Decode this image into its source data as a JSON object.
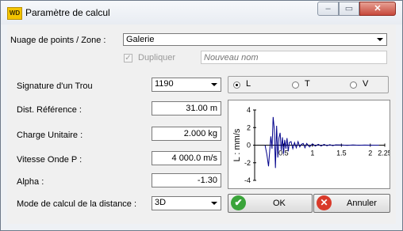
{
  "window": {
    "title": "Paramètre de calcul",
    "app_icon": "WD"
  },
  "titlebar_buttons": {
    "minimize": "–",
    "maximize": "▭",
    "close": "✕"
  },
  "zone": {
    "label": "Nuage de points / Zone :",
    "value": "Galerie"
  },
  "duplicate": {
    "label": "Dupliquer",
    "checked": true,
    "placeholder": "Nouveau nom"
  },
  "signature": {
    "label": "Signature d'un Trou",
    "value": "1190"
  },
  "reference": {
    "label": "Dist. Référence :",
    "value": "31.00 m"
  },
  "charge": {
    "label": "Charge Unitaire :",
    "value": "2.000 kg"
  },
  "vitesse": {
    "label": "Vitesse Onde P :",
    "value": "4 000.0 m/s"
  },
  "alpha": {
    "label": "Alpha :",
    "value": "-1.30"
  },
  "mode": {
    "label": "Mode de calcul de la distance :",
    "value": "3D"
  },
  "axis_radio": {
    "selected": "L",
    "options": [
      "L",
      "T",
      "V"
    ]
  },
  "buttons": {
    "ok": "OK",
    "cancel": "Annuler",
    "ok_icon": "✔",
    "cancel_icon": "✕"
  },
  "colors": {
    "series": "#00008b",
    "ok_green": "#3aa43a",
    "cancel_red": "#d93a2a"
  },
  "chart_data": {
    "type": "line",
    "ylabel": "L : mm/s",
    "xlabel": "",
    "xlim": [
      0,
      2.25
    ],
    "ylim": [
      -4,
      4
    ],
    "x_ticks": [
      "0.5",
      "1",
      "1.5",
      "2",
      "2.25"
    ],
    "y_ticks": [
      "4",
      "2",
      "0",
      "-2",
      "-4"
    ],
    "grid": false,
    "series": [
      {
        "name": "",
        "x": [
          0.18,
          0.21,
          0.24,
          0.26,
          0.28,
          0.3,
          0.32,
          0.34,
          0.36,
          0.38,
          0.4,
          0.42,
          0.44,
          0.46,
          0.48,
          0.5,
          0.52,
          0.54,
          0.56,
          0.58,
          0.6,
          0.63,
          0.66,
          0.69,
          0.72,
          0.75,
          0.78,
          0.81,
          0.84,
          0.87,
          0.9,
          0.95,
          1.0,
          1.05,
          1.1,
          1.15,
          1.2,
          1.25,
          1.3,
          1.35,
          1.4,
          1.5,
          1.6,
          1.7,
          1.8,
          1.9,
          2.0,
          2.1,
          2.15
        ],
        "y": [
          0,
          -1.0,
          -2.4,
          -0.6,
          1.0,
          -0.4,
          3.2,
          1.8,
          -2.6,
          2.2,
          -1.4,
          0.8,
          1.4,
          -0.6,
          0.9,
          -1.0,
          0.6,
          -0.4,
          0.8,
          -0.7,
          0.3,
          0.4,
          -0.4,
          0.3,
          -0.3,
          0.4,
          -0.2,
          0.1,
          0.2,
          -0.3,
          0.2,
          -0.2,
          0.15,
          -0.1,
          0.1,
          -0.1,
          0.08,
          -0.06,
          0.05,
          -0.05,
          0.04,
          0.02,
          -0.02,
          0.02,
          -0.01,
          0.01,
          0.0,
          0.0,
          0.0
        ]
      }
    ]
  }
}
